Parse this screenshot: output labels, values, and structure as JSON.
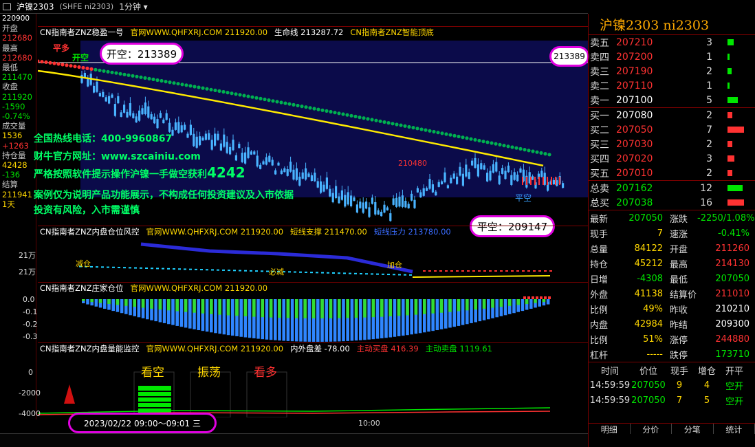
{
  "topbar": {
    "symbol": "沪镍2303",
    "code": "(SHFE ni2303)",
    "period": "1分钟"
  },
  "leftcol": {
    "top_value": "220900",
    "items": [
      {
        "label": "开盘",
        "value": "212680"
      },
      {
        "label": "最高",
        "value": "212680"
      },
      {
        "label": "最低",
        "value": "211470"
      },
      {
        "label": "收盘",
        "value": "211920"
      },
      {
        "label": "",
        "value": "-1590"
      },
      {
        "label": "",
        "value": "-0.74%"
      },
      {
        "label": "成交量",
        "value": "1536"
      },
      {
        "label": "",
        "value": "+1263"
      },
      {
        "label": "持仓量",
        "value": "42428"
      },
      {
        "label": "",
        "value": "-136"
      },
      {
        "label": "结算",
        "value": "211941"
      },
      {
        "label": "",
        "value": "1天"
      }
    ]
  },
  "panel1": {
    "head": [
      "CN指南者ZNZ稳盈一号",
      "官网WWW.QHFXRJ.COM 211920.00",
      "生命线 213287.72",
      "CN指南者ZNZ智能顶底"
    ],
    "labels": {
      "pingduo": "平多",
      "kaikong": "开空",
      "price_210480": "210480",
      "pingkong": "平空",
      "right_price": "213389"
    },
    "callout_open": "开空：213389",
    "callout_close": "平空：209147",
    "texts": [
      "全国热线电话：400-9960867",
      "财牛官方网址：www.szcainiu.com",
      "严格按照软件提示操作沪镍一手做空获利",
      "案例仅为说明产品功能展示，不构成任何投资建议及入市依据",
      "投资有风险，入市需谨慎"
    ],
    "profit": "4242"
  },
  "panel2": {
    "head": [
      "CN指南者ZNZ内盘仓位风控",
      "官网WWW.QHFXRJ.COM 211920.00",
      "短线支撑 211470.00",
      "短线压力 213780.00"
    ],
    "y": [
      "21万",
      "21万"
    ],
    "labels": {
      "jian1": "减仓",
      "jian2": "必减",
      "jia": "加仓"
    }
  },
  "panel3": {
    "head": [
      "CN指南者ZNZ庄家仓位",
      "官网WWW.QHFXRJ.COM 211920.00"
    ],
    "y": [
      "0.0",
      "-0.1",
      "-0.2",
      "-0.3"
    ]
  },
  "panel4": {
    "head": [
      "CN指南者ZNZ内盘量能监控",
      "官网WWW.QHFXRJ.COM 211920.00",
      "内外盘差 -78.00",
      "主动买盘 416.39",
      "主动卖盘 1119.61"
    ],
    "y": [
      "0",
      "-2000",
      "-4000"
    ],
    "boxes": [
      "看空",
      "振荡",
      "看多"
    ]
  },
  "timeaxis": {
    "cursor": "2023/02/22 09:00～09:01 三",
    "tick": "10:00"
  },
  "orderbook": {
    "title": "沪镍2303  ni2303",
    "asks": [
      {
        "label": "卖五",
        "price": "207210",
        "qty": "3"
      },
      {
        "label": "卖四",
        "price": "207200",
        "qty": "1"
      },
      {
        "label": "卖三",
        "price": "207190",
        "qty": "2"
      },
      {
        "label": "卖二",
        "price": "207110",
        "qty": "1"
      },
      {
        "label": "卖一",
        "price": "207100",
        "qty": "5"
      }
    ],
    "bids": [
      {
        "label": "买一",
        "price": "207080",
        "qty": "2"
      },
      {
        "label": "买二",
        "price": "207050",
        "qty": "7"
      },
      {
        "label": "买三",
        "price": "207030",
        "qty": "2"
      },
      {
        "label": "买四",
        "price": "207020",
        "qty": "3"
      },
      {
        "label": "买五",
        "price": "207010",
        "qty": "2"
      }
    ],
    "totals": [
      {
        "label": "总卖",
        "price": "207162",
        "qty": "12"
      },
      {
        "label": "总买",
        "price": "207038",
        "qty": "16"
      }
    ]
  },
  "stats": [
    {
      "l1": "最新",
      "v1": "207050",
      "l2": "涨跌",
      "v2": "-2250/1.08%"
    },
    {
      "l1": "现手",
      "v1": "7",
      "l2": "速涨",
      "v2": "-0.41%"
    },
    {
      "l1": "总量",
      "v1": "84122",
      "l2": "开盘",
      "v2": "211260"
    },
    {
      "l1": "持仓",
      "v1": "45212",
      "l2": "最高",
      "v2": "214130"
    },
    {
      "l1": "日增",
      "v1": "-4308",
      "l2": "最低",
      "v2": "207050"
    },
    {
      "l1": "外盘",
      "v1": "41138",
      "l2": "结算价",
      "v2": "211010"
    },
    {
      "l1": "比例",
      "v1": "49%",
      "l2": "昨收",
      "v2": "210210"
    },
    {
      "l1": "内盘",
      "v1": "42984",
      "l2": "昨结",
      "v2": "209300"
    },
    {
      "l1": "比例",
      "v1": "51%",
      "l2": "涨停",
      "v2": "244880"
    },
    {
      "l1": "杠杆",
      "v1": "-----",
      "l2": "跌停",
      "v2": "173710"
    }
  ],
  "ticks": {
    "header": [
      "时间",
      "价位",
      "现手",
      "增仓",
      "开平"
    ],
    "rows": [
      {
        "time": "14:59:59",
        "price": "207050",
        "vol": "9",
        "oi": "4",
        "type": "空开"
      },
      {
        "time": "14:59:59",
        "price": "207050",
        "vol": "7",
        "oi": "5",
        "type": "空开"
      }
    ]
  },
  "tabs": [
    "明细",
    "分价",
    "分笔",
    "统计"
  ]
}
